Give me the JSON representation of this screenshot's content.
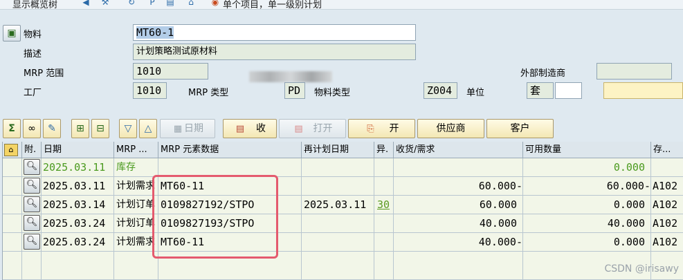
{
  "topbar": {
    "item1": "显示概览树",
    "item2": "单个项目，单一级别计划"
  },
  "header": {
    "material_label": "物料",
    "material_value": "MT60-1",
    "desc_label": "描述",
    "desc_value": "计划策略测试原材料",
    "mrp_area_label": "MRP 范围",
    "mrp_area_value": "1010",
    "external_mfr_label": "外部制造商",
    "plant_label": "工厂",
    "plant_value": "1010",
    "mrp_type_label": "MRP 类型",
    "mrp_type_value": "PD",
    "material_type_label": "物料类型",
    "material_type_value": "Z004",
    "unit_label": "单位",
    "unit_value": "套"
  },
  "toolbar": {
    "date_label": "日期",
    "receipt_label": "收",
    "open_label": "打开",
    "open2_label": "开",
    "supplier_label": "供应商",
    "customer_label": "客户"
  },
  "grid": {
    "columns": [
      "附.",
      "日期",
      "MRP ...",
      "MRP 元素数据",
      "再计划日期",
      "异.",
      "收货/需求",
      "可用数量",
      "存..."
    ],
    "rows": [
      {
        "date": "2025.03.11",
        "mrp": "库存",
        "element": "",
        "reschedule": "",
        "exception": "",
        "qty": "",
        "available": "0.000",
        "storage": ""
      },
      {
        "date": "2025.03.11",
        "mrp": "计划需求",
        "element": "MT60-11",
        "reschedule": "",
        "exception": "",
        "qty": "60.000-",
        "available": "60.000-",
        "storage": "A102"
      },
      {
        "date": "2025.03.14",
        "mrp": "计划订单",
        "element": "0109827192/STPO",
        "reschedule": "2025.03.11",
        "exception": "30",
        "qty": "60.000",
        "available": "0.000",
        "storage": "A102"
      },
      {
        "date": "2025.03.24",
        "mrp": "计划订单",
        "element": "0109827193/STPO",
        "reschedule": "",
        "exception": "",
        "qty": "40.000",
        "available": "40.000",
        "storage": "A102"
      },
      {
        "date": "2025.03.24",
        "mrp": "计划需求",
        "element": "MT60-11",
        "reschedule": "",
        "exception": "",
        "qty": "40.000-",
        "available": "0.000",
        "storage": "A102"
      }
    ]
  },
  "watermark": "CSDN @irisawy"
}
